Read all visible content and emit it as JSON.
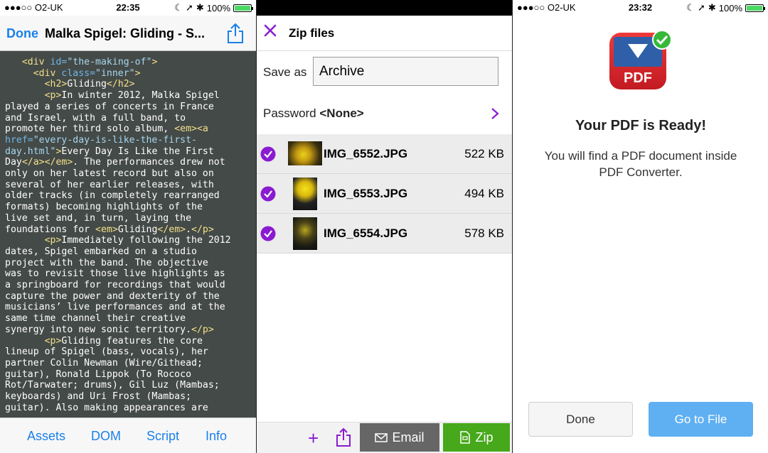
{
  "colors": {
    "ios_blue": "#1a80e8",
    "purple_accent": "#8a1bd1",
    "zip_green": "#46a81a",
    "email_gray": "#666666",
    "go_blue": "#5fb0f2",
    "pdf_red": "#d0202a"
  },
  "left_panel": {
    "status": {
      "carrier": "●●●○○ O2-UK",
      "time": "22:35",
      "battery": "100%"
    },
    "nav": {
      "done_label": "Done",
      "title": "Malka Spigel: Gliding - S...",
      "share_icon": "share-icon"
    },
    "code_lines": [
      {
        "indent": "   ",
        "parts": [
          [
            "tag",
            "<div "
          ],
          [
            "attr",
            "id="
          ],
          [
            "str",
            "\"the-making-of\""
          ],
          [
            "tag",
            ">"
          ]
        ]
      },
      {
        "indent": "     ",
        "parts": [
          [
            "tag",
            "<div "
          ],
          [
            "attr",
            "class="
          ],
          [
            "str",
            "\"inner\""
          ],
          [
            "tag",
            ">"
          ]
        ]
      },
      {
        "indent": "       ",
        "parts": [
          [
            "tag",
            "<h2>"
          ],
          [
            "text",
            "Gliding"
          ],
          [
            "tag",
            "</h2>"
          ]
        ]
      },
      {
        "indent": "       ",
        "parts": [
          [
            "tag",
            "<p>"
          ],
          [
            "text",
            "In winter 2012, Malka Spigel"
          ]
        ]
      },
      {
        "indent": "",
        "parts": [
          [
            "text",
            "played a series of concerts in France"
          ]
        ]
      },
      {
        "indent": "",
        "parts": [
          [
            "text",
            "and Israel, with a full band, to"
          ]
        ]
      },
      {
        "indent": "",
        "parts": [
          [
            "text",
            "promote her third solo album, "
          ],
          [
            "tag",
            "<em><a"
          ]
        ]
      },
      {
        "indent": "",
        "parts": [
          [
            "attr",
            "href="
          ],
          [
            "str",
            "\"every-day-is-like-the-first-"
          ]
        ]
      },
      {
        "indent": "",
        "parts": [
          [
            "str",
            "day.html\""
          ],
          [
            "tag",
            ">"
          ],
          [
            "text",
            "Every Day Is Like the First"
          ]
        ]
      },
      {
        "indent": "",
        "parts": [
          [
            "text",
            "Day"
          ],
          [
            "tag",
            "</a></em>"
          ],
          [
            "text",
            ". The performances drew not"
          ]
        ]
      },
      {
        "indent": "",
        "parts": [
          [
            "text",
            "only on her latest record but also on"
          ]
        ]
      },
      {
        "indent": "",
        "parts": [
          [
            "text",
            "several of her earlier releases, with"
          ]
        ]
      },
      {
        "indent": "",
        "parts": [
          [
            "text",
            "older tracks (in completely rearranged"
          ]
        ]
      },
      {
        "indent": "",
        "parts": [
          [
            "text",
            "formats) becoming highlights of the"
          ]
        ]
      },
      {
        "indent": "",
        "parts": [
          [
            "text",
            "live set and, in turn, laying the"
          ]
        ]
      },
      {
        "indent": "",
        "parts": [
          [
            "text",
            "foundations for "
          ],
          [
            "tag",
            "<em>"
          ],
          [
            "text",
            "Gliding"
          ],
          [
            "tag",
            "</em>"
          ],
          [
            "text",
            "."
          ],
          [
            "tag",
            "</p>"
          ]
        ]
      },
      {
        "indent": "       ",
        "parts": [
          [
            "tag",
            "<p>"
          ],
          [
            "text",
            "Immediately following the 2012"
          ]
        ]
      },
      {
        "indent": "",
        "parts": [
          [
            "text",
            "dates, Spigel embarked on a studio"
          ]
        ]
      },
      {
        "indent": "",
        "parts": [
          [
            "text",
            "project with the band. The objective"
          ]
        ]
      },
      {
        "indent": "",
        "parts": [
          [
            "text",
            "was to revisit those live highlights as"
          ]
        ]
      },
      {
        "indent": "",
        "parts": [
          [
            "text",
            "a springboard for recordings that would"
          ]
        ]
      },
      {
        "indent": "",
        "parts": [
          [
            "text",
            "capture the power and dexterity of the"
          ]
        ]
      },
      {
        "indent": "",
        "parts": [
          [
            "text",
            "musicians’ live performances and at the"
          ]
        ]
      },
      {
        "indent": "",
        "parts": [
          [
            "text",
            "same time channel their creative"
          ]
        ]
      },
      {
        "indent": "",
        "parts": [
          [
            "text",
            "synergy into new sonic territory."
          ],
          [
            "tag",
            "</p>"
          ]
        ]
      },
      {
        "indent": "       ",
        "parts": [
          [
            "tag",
            "<p>"
          ],
          [
            "text",
            "Gliding features the core"
          ]
        ]
      },
      {
        "indent": "",
        "parts": [
          [
            "text",
            "lineup of Spigel (bass, vocals), her"
          ]
        ]
      },
      {
        "indent": "",
        "parts": [
          [
            "text",
            "partner Colin Newman (Wire/Githead;"
          ]
        ]
      },
      {
        "indent": "",
        "parts": [
          [
            "text",
            "guitar), Ronald Lippok (To Rococo"
          ]
        ]
      },
      {
        "indent": "",
        "parts": [
          [
            "text",
            "Rot/Tarwater; drums), Gil Luz (Mambas;"
          ]
        ]
      },
      {
        "indent": "",
        "parts": [
          [
            "text",
            "keyboards) and Uri Frost (Mambas;"
          ]
        ]
      },
      {
        "indent": "",
        "parts": [
          [
            "text",
            "guitar). Also making appearances are"
          ]
        ]
      }
    ],
    "tabs": [
      "Assets",
      "DOM",
      "Script",
      "Info"
    ]
  },
  "middle_panel": {
    "header": {
      "title": "Zip files",
      "close_icon": "close-icon"
    },
    "save_as": {
      "label": "Save as",
      "value": "Archive"
    },
    "password": {
      "label": "Password",
      "value": "<None>"
    },
    "files": [
      {
        "name": "IMG_6552.JPG",
        "size": "522 KB",
        "selected": true,
        "thumb": "landscape"
      },
      {
        "name": "IMG_6553.JPG",
        "size": "494 KB",
        "selected": true,
        "thumb": "portrait"
      },
      {
        "name": "IMG_6554.JPG",
        "size": "578 KB",
        "selected": true,
        "thumb": "portrait-dark"
      }
    ],
    "bottom": {
      "plus_label": "+",
      "email_label": "Email",
      "zip_label": "Zip"
    }
  },
  "right_panel": {
    "status": {
      "carrier": "●●●○○ O2-UK",
      "time": "23:32",
      "battery": "100%"
    },
    "app_icon_text": "PDF",
    "heading": "Your PDF is Ready!",
    "message": "You will find a PDF document inside PDF Converter.",
    "done_label": "Done",
    "go_label": "Go to File"
  }
}
